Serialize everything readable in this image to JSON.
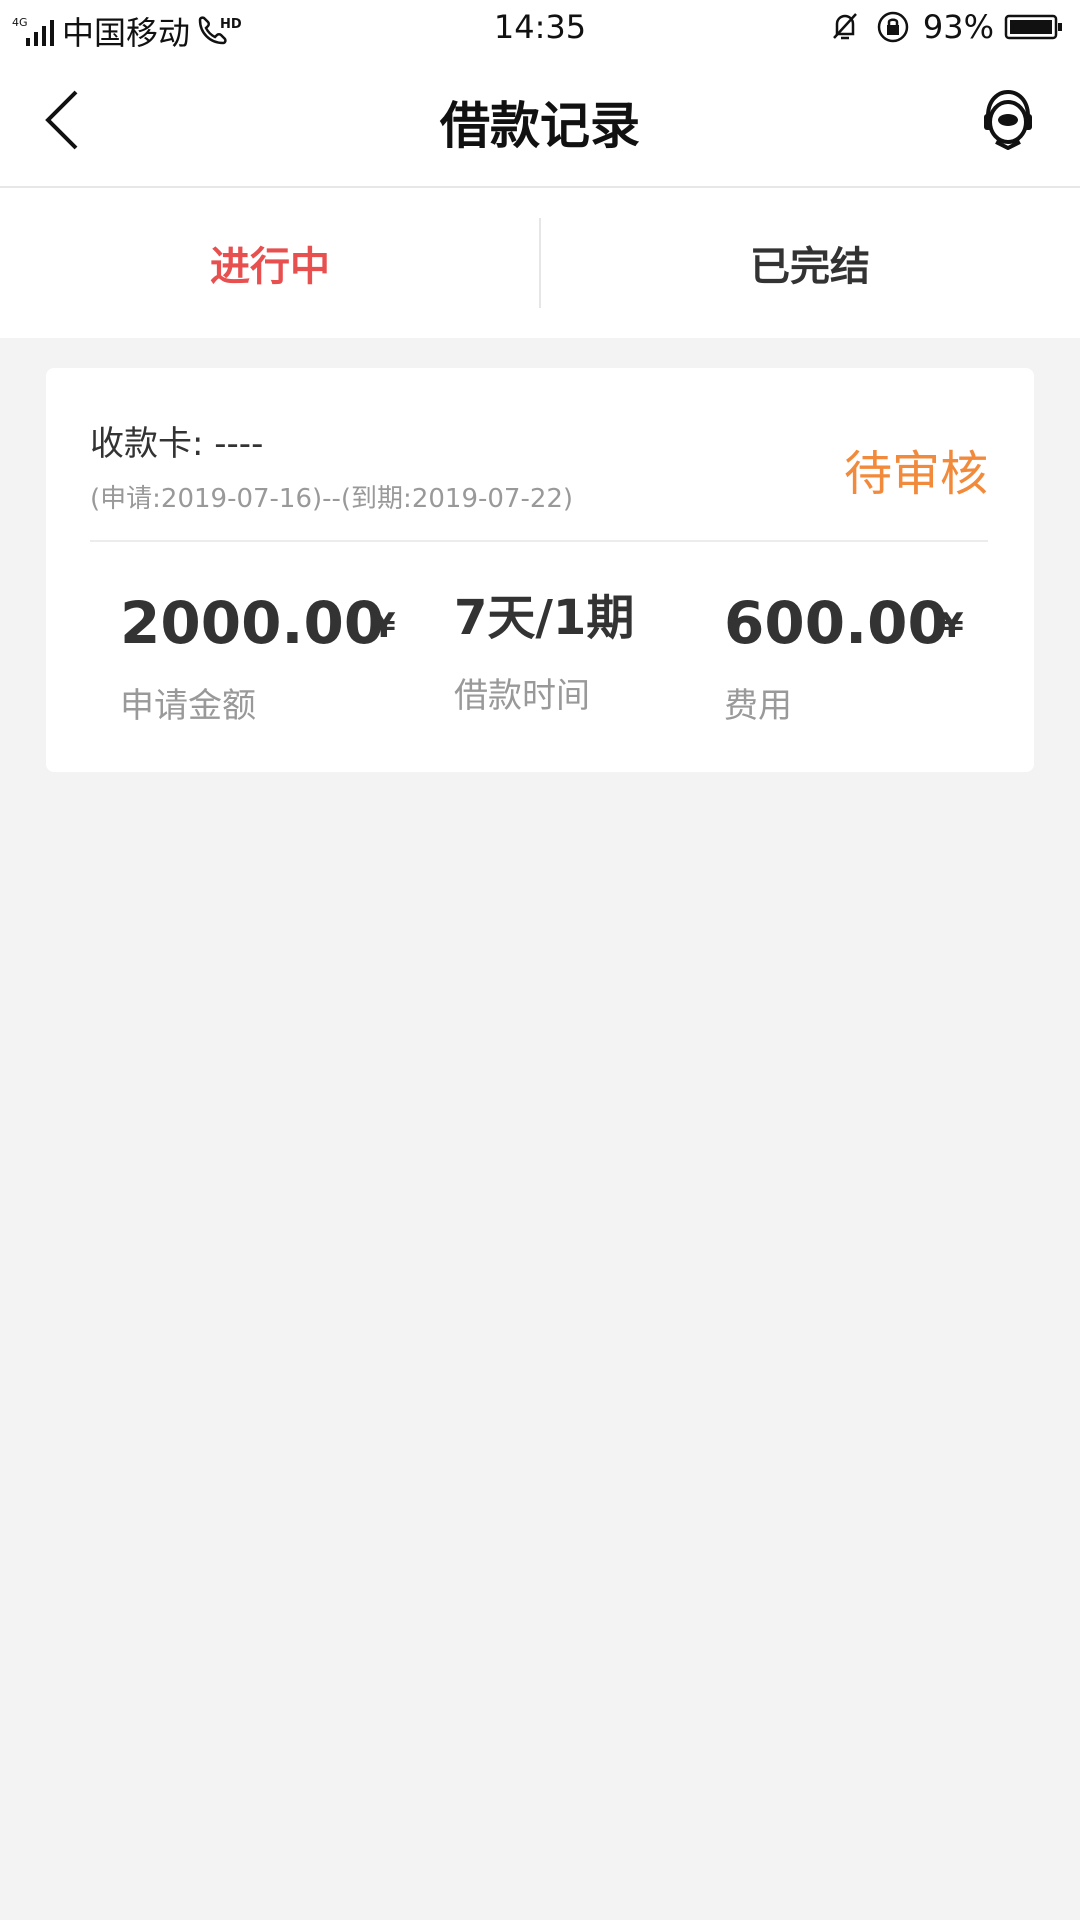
{
  "status_bar": {
    "network": "4G",
    "carrier": "中国移动",
    "hd": "HD",
    "time": "14:35",
    "battery_percent": "93%"
  },
  "nav": {
    "title": "借款记录"
  },
  "tabs": [
    {
      "label": "进行中",
      "active": true
    },
    {
      "label": "已完结",
      "active": false
    }
  ],
  "record": {
    "card_label": "收款卡: ----",
    "dates": "(申请:2019-07-16)--(到期:2019-07-22)",
    "status": "待审核",
    "metrics": [
      {
        "value": "2000.00",
        "unit": "¥",
        "label": "申请金额"
      },
      {
        "value": "7天/1期",
        "unit": "",
        "label": "借款时间"
      },
      {
        "value": "600.00",
        "unit": "¥",
        "label": "费用"
      }
    ]
  },
  "colors": {
    "active_tab": "#e84f4f",
    "status_pending": "#f28a3b"
  }
}
